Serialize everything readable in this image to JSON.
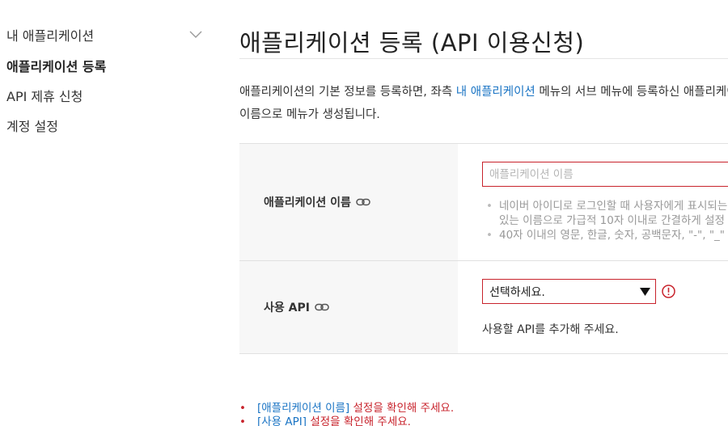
{
  "sidebar": {
    "section_label": "내 애플리케이션",
    "items": [
      {
        "label": "애플리케이션 등록"
      },
      {
        "label": "API 제휴 신청"
      },
      {
        "label": "계정 설정"
      }
    ]
  },
  "main": {
    "title": "애플리케이션 등록 (API 이용신청)",
    "description": {
      "before": "애플리케이션의 기본 정보를 등록하면, 좌측 ",
      "link": "내 애플리케이션",
      "after": " 메뉴의 서브 메뉴에 등록하신 애플리케이션 이름으로 메뉴가 생성됩니다."
    },
    "form": {
      "app_name": {
        "label": "애플리케이션 이름",
        "placeholder": "애플리케이션 이름",
        "help": [
          "네이버 아이디로 로그인할 때 사용자에게 표시되는",
          "있는 이름으로 가급적 10자 이내로 간결하게 설정",
          "40자 이내의 영문, 한글, 숫자, 공백문자, \"-\", \"_\""
        ]
      },
      "api": {
        "label": "사용 API",
        "selected": "선택하세요.",
        "help": "사용할 API를 추가해 주세요."
      }
    },
    "errors": [
      {
        "field": "[애플리케이션 이름]",
        "message": " 설정을 확인해 주세요."
      },
      {
        "field": "[사용 API]",
        "message": " 설정을 확인해 주세요."
      }
    ]
  },
  "colors": {
    "accent_link": "#1a74c4",
    "error": "#c8232c",
    "label_bg": "#f7f7f7",
    "border": "#e1e1e1"
  }
}
